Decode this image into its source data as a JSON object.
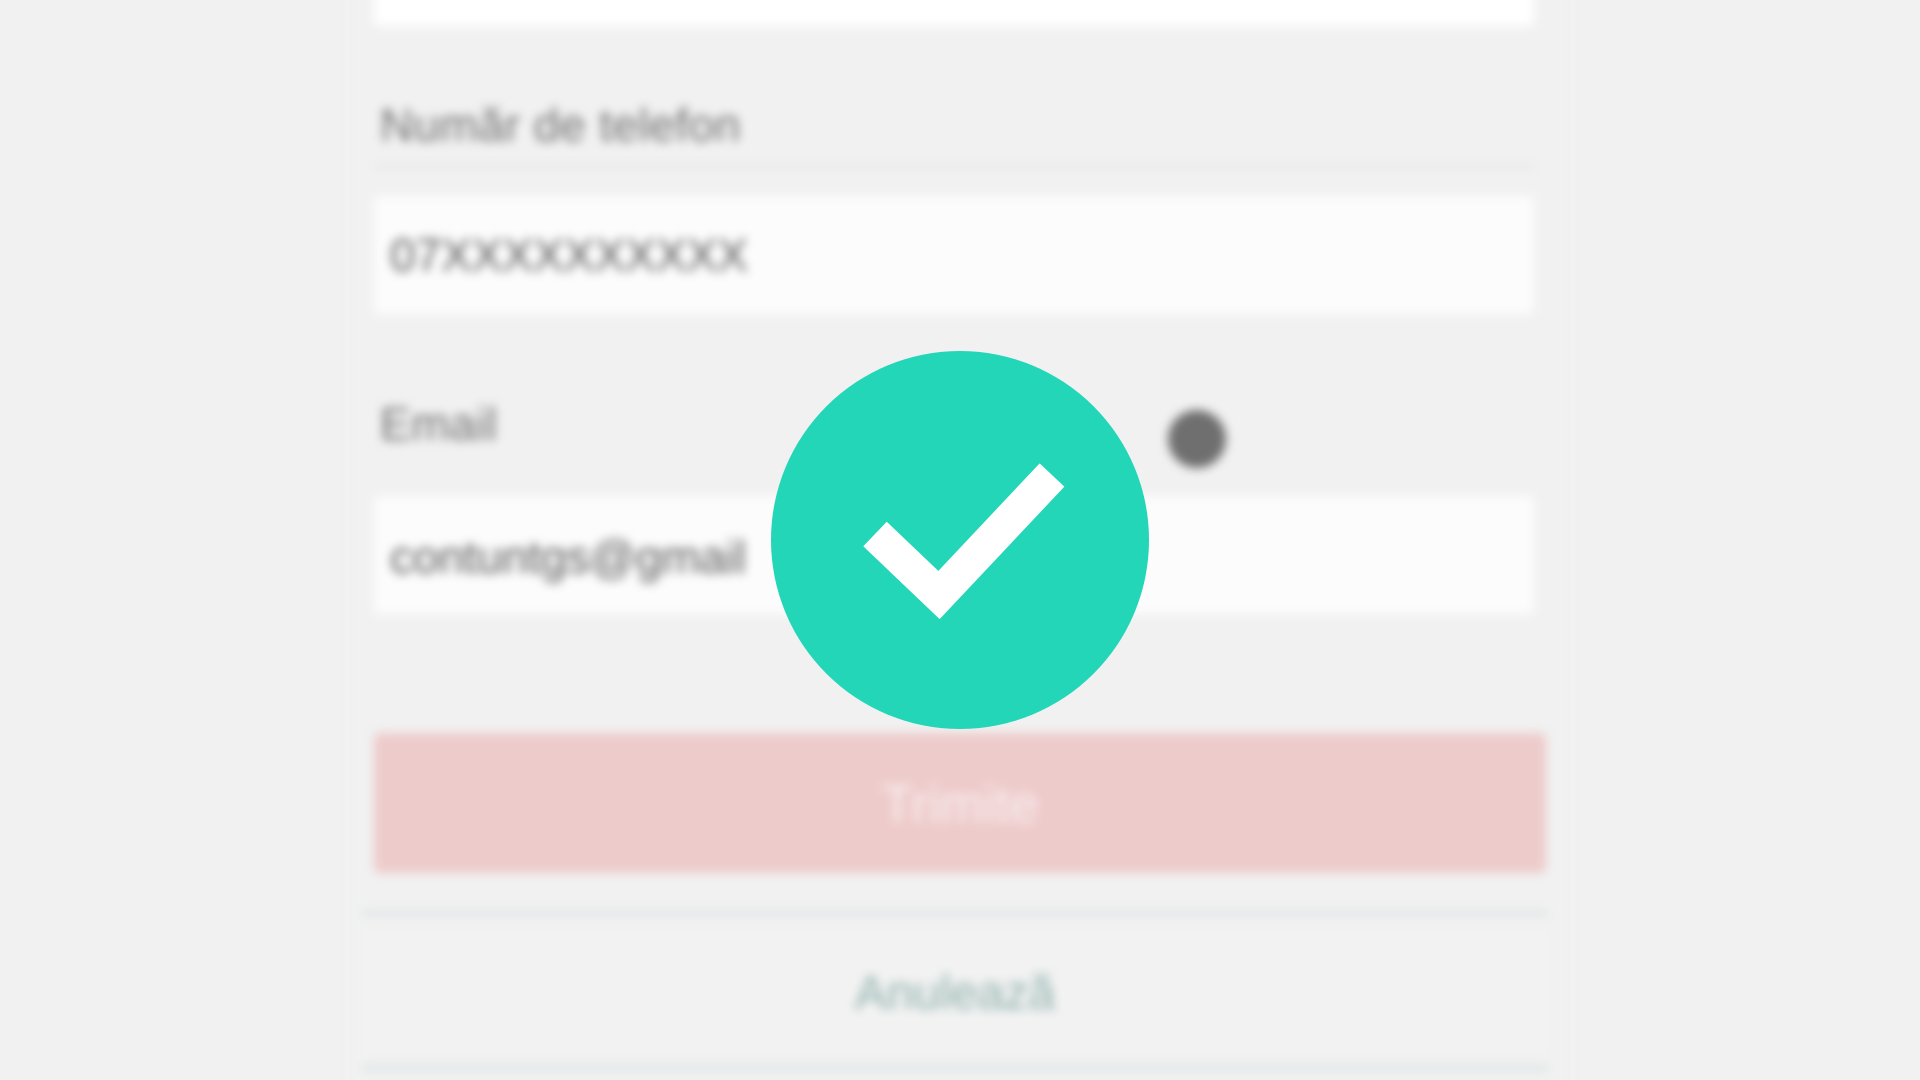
{
  "form": {
    "phone_label": "Număr de telefon",
    "phone_value": "07XXXXXXXXXX",
    "email_label": "Email",
    "email_value": "contuntgs@gmail",
    "submit_label": "Trimite",
    "secondary_label": "Anulează"
  },
  "overlay": {
    "icon": "checkmark-icon",
    "badge_color": "#22d6b7"
  }
}
